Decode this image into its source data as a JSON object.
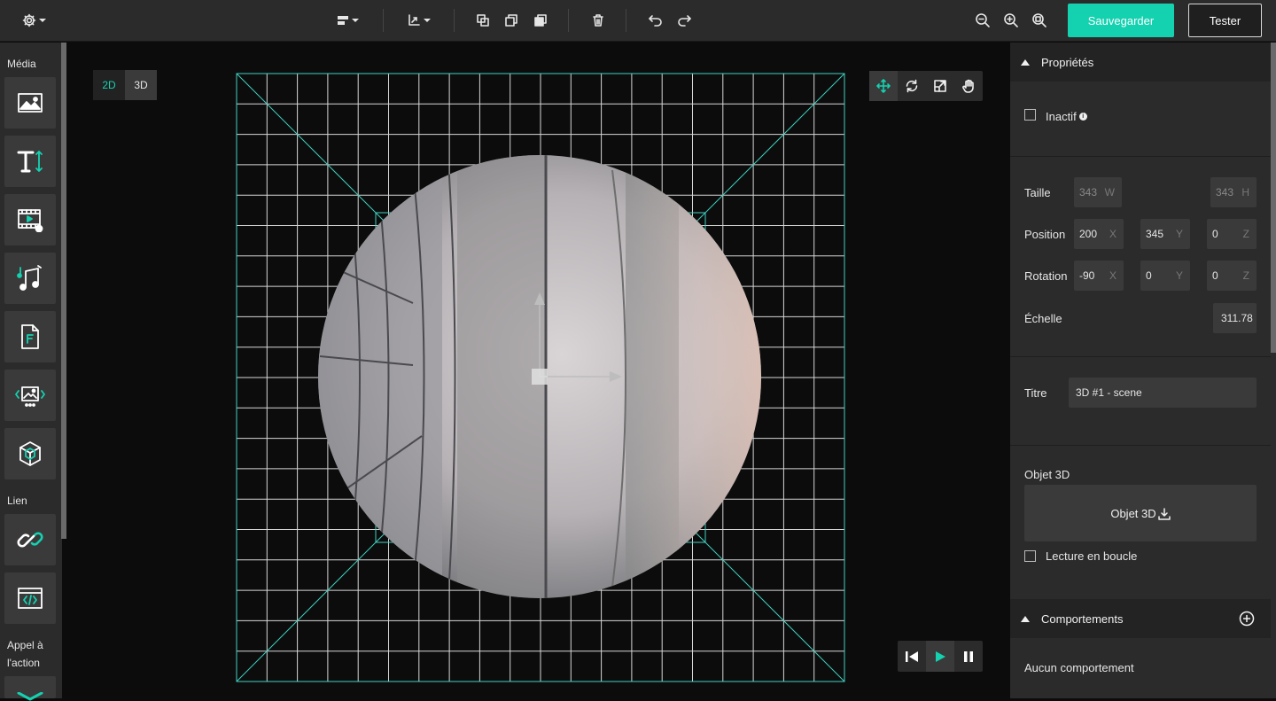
{
  "toolbar": {
    "save_label": "Sauvegarder",
    "test_label": "Tester"
  },
  "sidebar": {
    "sections": [
      {
        "label": "Média",
        "items": [
          "image-icon",
          "text-icon",
          "video-icon",
          "audio-icon",
          "file-icon",
          "slider-icon",
          "cube-3d-icon"
        ]
      },
      {
        "label": "Lien",
        "items": [
          "link-icon",
          "embed-code-icon"
        ]
      },
      {
        "label_line1": "Appel à",
        "label_line2": "l'action",
        "items": [
          "email-icon"
        ]
      }
    ]
  },
  "canvas": {
    "mode_2d": "2D",
    "mode_3d": "3D",
    "active_mode": "2D"
  },
  "properties": {
    "header": "Propriétés",
    "inactive_label": "Inactif",
    "size_label": "Taille",
    "size_w": "343",
    "size_w_axis": "W",
    "size_h": "343",
    "size_h_axis": "H",
    "position_label": "Position",
    "pos_x": "200",
    "pos_y": "345",
    "pos_z": "0",
    "rotation_label": "Rotation",
    "rot_x": "-90",
    "rot_y": "0",
    "rot_z": "0",
    "axis_x": "X",
    "axis_y": "Y",
    "axis_z": "Z",
    "scale_label": "Échelle",
    "scale_value": "311.78",
    "title_label": "Titre",
    "title_value": "3D #1 - scene",
    "object3d_label": "Objet 3D",
    "object3d_button": "Objet 3D",
    "loop_label": "Lecture en boucle"
  },
  "behaviors": {
    "header": "Comportements",
    "empty_text": "Aucun comportement"
  },
  "colors": {
    "accent": "#14d1b0",
    "panel": "#2b2b2b",
    "field": "#3a3a3a",
    "canvas": "#0c0c0c"
  }
}
